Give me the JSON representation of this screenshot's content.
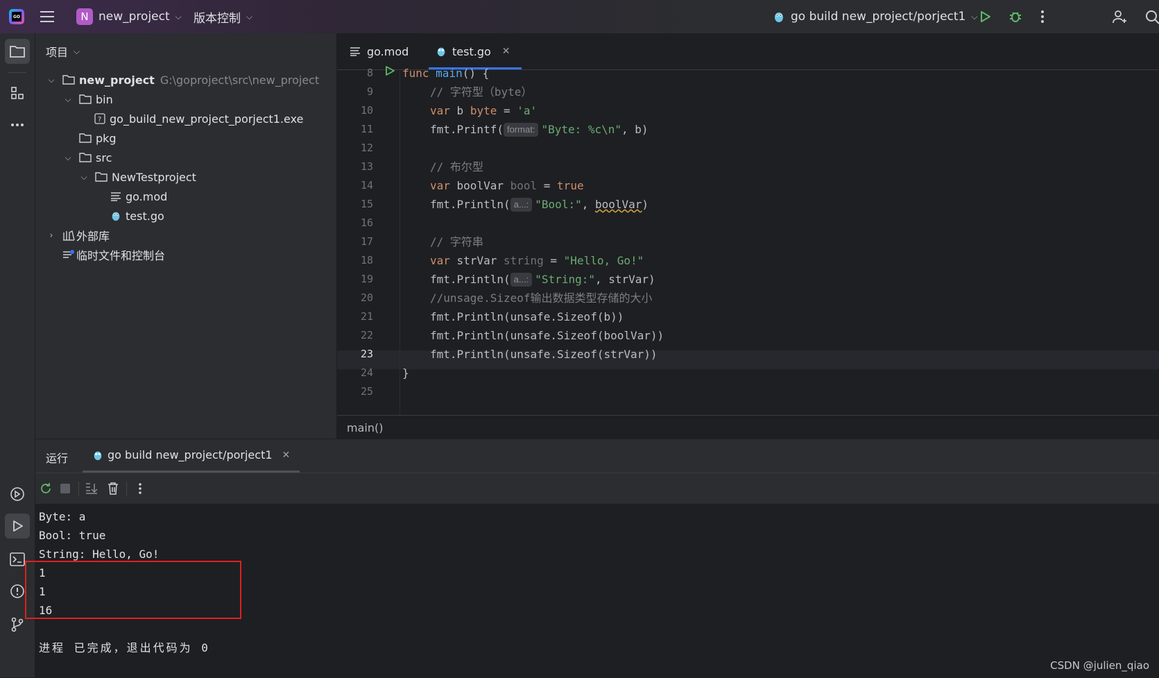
{
  "titlebar": {
    "project_badge": "N",
    "project_name": "new_project",
    "vcs_label": "版本控制",
    "run_config": "go build new_project/porject1",
    "colors": {
      "run": "#5fb865",
      "debug": "#5fb865",
      "badge": "#b15bc7"
    }
  },
  "project_panel": {
    "title": "项目",
    "tree": [
      {
        "label": "new_project",
        "hint": "G:\\goproject\\src\\new_project",
        "icon": "folder-icon"
      },
      {
        "label": "bin",
        "icon": "folder-icon"
      },
      {
        "label": "go_build_new_project_porject1.exe",
        "icon": "unknown-file-icon"
      },
      {
        "label": "pkg",
        "icon": "folder-icon"
      },
      {
        "label": "src",
        "icon": "folder-icon"
      },
      {
        "label": "NewTestproject",
        "icon": "folder-icon"
      },
      {
        "label": "go.mod",
        "icon": "text-file-icon"
      },
      {
        "label": "test.go",
        "icon": "gopher-icon"
      },
      {
        "label": "外部库",
        "icon": "library-icon"
      },
      {
        "label": "临时文件和控制台",
        "icon": "scratch-icon"
      }
    ]
  },
  "editor": {
    "tabs": [
      {
        "label": "go.mod",
        "icon": "text-file-icon"
      },
      {
        "label": "test.go",
        "icon": "gopher-icon"
      }
    ],
    "line_numbers": [
      "8",
      "9",
      "10",
      "11",
      "12",
      "13",
      "14",
      "15",
      "16",
      "17",
      "18",
      "19",
      "20",
      "21",
      "22",
      "23",
      "24",
      "25"
    ],
    "code": {
      "l8_kw": "func",
      "l8_fn": "main",
      "l8_rest": "() {",
      "l9": "// 字符型（byte）",
      "l10_kw": "var",
      "l10_name": " b ",
      "l10_type": "byte",
      "l10_eq": " = ",
      "l10_str": "'a'",
      "l11_pre": "fmt.Printf(",
      "l11_hint": "format:",
      "l11_str": "\"Byte: %c\\n\"",
      "l11_post": ", b)",
      "l13": "// 布尔型",
      "l14_kw": "var",
      "l14_name": " boolVar ",
      "l14_type": "bool",
      "l14_eq": " = ",
      "l14_val": "true",
      "l15_pre": "fmt.Println(",
      "l15_hint": "a...:",
      "l15_str": "\"Bool:\"",
      "l15_mid": ", ",
      "l15_var": "boolVar",
      "l15_post": ")",
      "l17": "// 字符串",
      "l18_kw": "var",
      "l18_name": " strVar ",
      "l18_type": "string",
      "l18_eq": " = ",
      "l18_str": "\"Hello, Go!\"",
      "l19_pre": "fmt.Println(",
      "l19_hint": "a...:",
      "l19_str": "\"String:\"",
      "l19_post": ", strVar)",
      "l20": "//unsage.Sizeof输出数据类型存储的大小",
      "l21": "fmt.Println(unsafe.Sizeof(b))",
      "l22": "fmt.Println(unsafe.Sizeof(boolVar))",
      "l23": "fmt.Println(unsafe.Sizeof(strVar))",
      "l24": "}"
    },
    "breadcrumb": "main()"
  },
  "run_panel": {
    "title": "运行",
    "tab_label": "go build new_project/porject1",
    "output": [
      "Byte: a",
      "Bool: true",
      "String: Hello, Go!",
      "1",
      "1",
      "16",
      "",
      "进程 已完成，退出代码为 0"
    ]
  },
  "watermark": "CSDN @julien_qiao"
}
